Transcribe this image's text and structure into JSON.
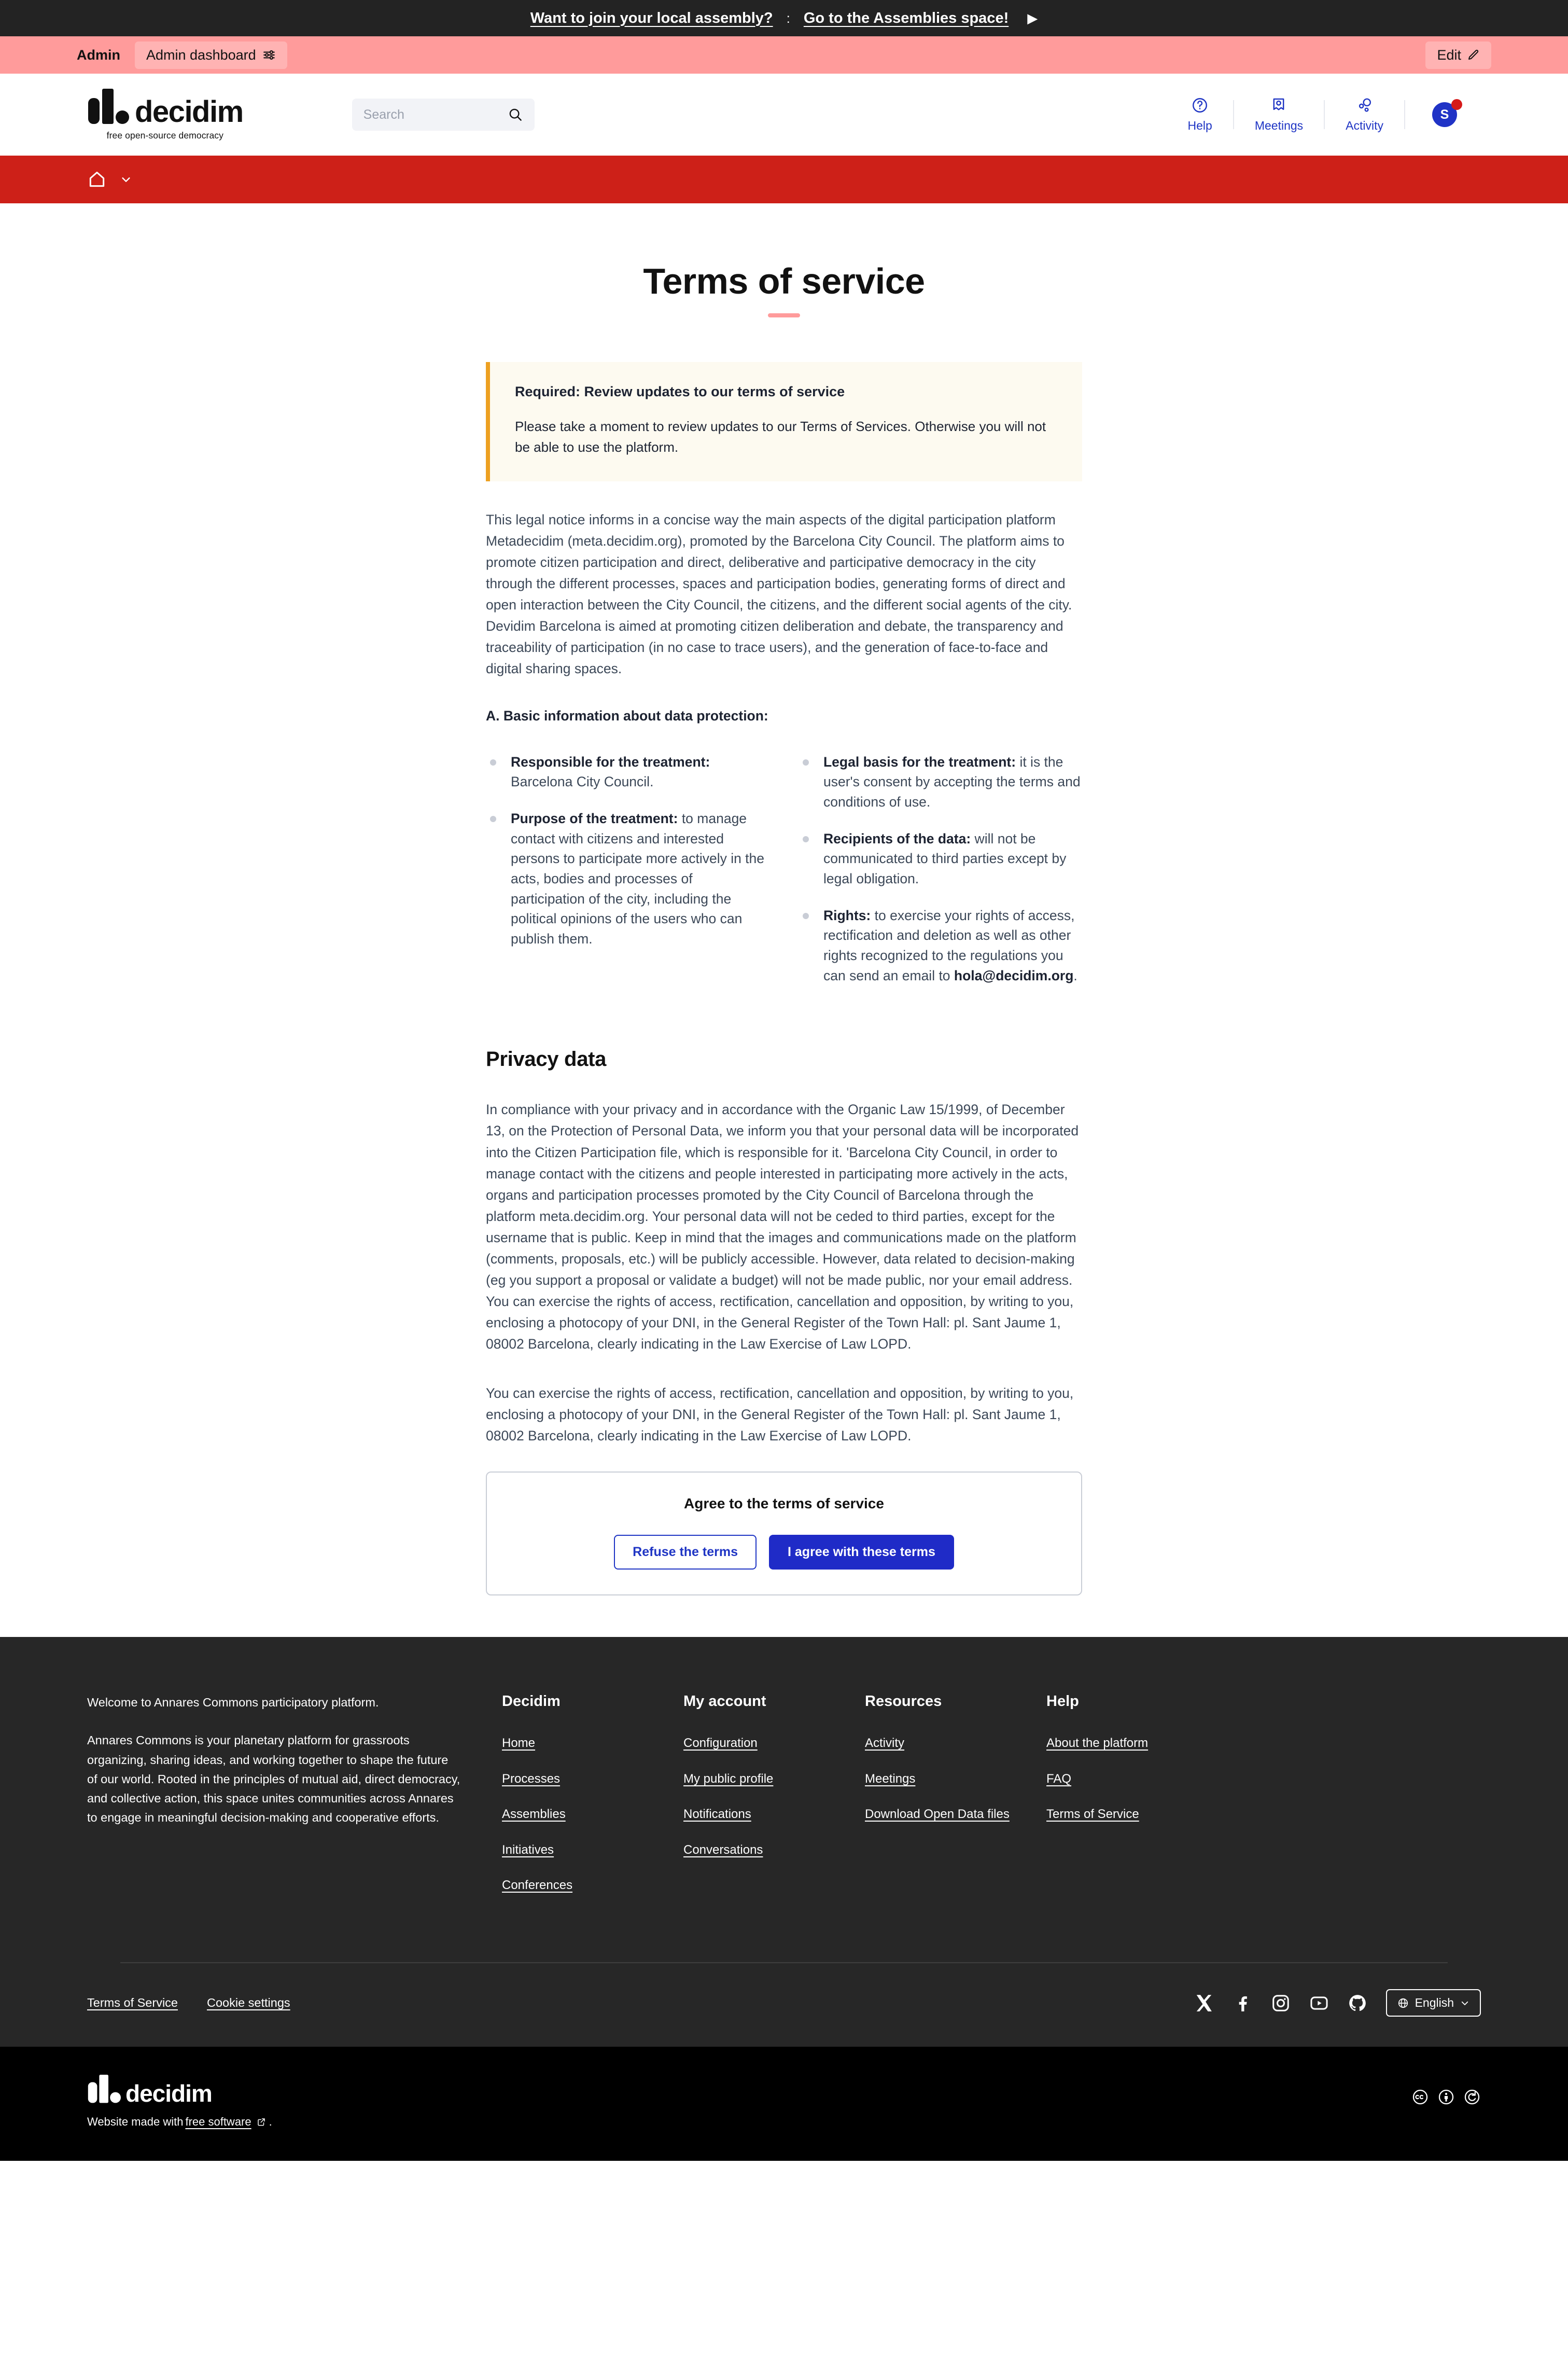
{
  "announcement": {
    "question": "Want to join your local assembly?",
    "separator": ":",
    "link": "Go to the Assemblies space!",
    "arrow": "▶"
  },
  "admin_bar": {
    "label": "Admin",
    "dashboard_button": "Admin dashboard",
    "edit_button": "Edit"
  },
  "header": {
    "logo_text": "decidim",
    "tagline": "free open-source democracy",
    "search_placeholder": "Search",
    "search_value": "",
    "actions": [
      {
        "label": "Help",
        "icon": "question-circle-icon"
      },
      {
        "label": "Meetings",
        "icon": "map-pin-icon"
      },
      {
        "label": "Activity",
        "icon": "activity-bubbles-icon"
      }
    ],
    "avatar_initial": "S",
    "avatar_has_notification": true
  },
  "navbar": {
    "home_icon": "home-icon",
    "chevron_icon": "chevron-down-icon"
  },
  "page": {
    "title": "Terms of service",
    "callout": {
      "title": "Required: Review updates to our terms of service",
      "body": "Please take a moment to review updates to our Terms of Services. Otherwise you will not be able to use the platform."
    },
    "intro_paragraph": "This legal notice informs in a concise way the main aspects of the digital participation platform Metadecidim (meta.decidim.org), promoted by the Barcelona City Council. The platform aims to promote citizen participation and direct, deliberative and participative democracy in the city through the different processes, spaces and participation bodies, generating forms of direct and open interaction between the City Council, the citizens, and the different social agents of the city. Devidim Barcelona is aimed at promoting citizen deliberation and debate, the transparency and traceability of participation (in no case to trace users), and the generation of face-to-face and digital sharing spaces.",
    "section_a_heading": "A. Basic information about data protection:",
    "bullets_left": [
      {
        "term": "Responsible for the treatment:",
        "text": " Barcelona City Council."
      },
      {
        "term": "Purpose of the treatment:",
        "text": " to manage contact with citizens and interested persons to participate more actively in the acts, bodies and processes of participation of the city, including the political opinions of the users who can publish them."
      }
    ],
    "bullets_right": [
      {
        "term": "Legal basis for the treatment:",
        "text": " it is the user's consent by accepting the terms and conditions of use."
      },
      {
        "term": "Recipients of the data:",
        "text": " will not be communicated to third parties except by legal obligation."
      },
      {
        "term": "Rights:",
        "text": " to exercise your rights of access, rectification and deletion as well as other rights recognized to the regulations you can send an email to ",
        "email": "hola@decidim.org",
        "suffix": "."
      }
    ],
    "privacy_heading": "Privacy data",
    "privacy_paragraph_1": "In compliance with your privacy and in accordance with the Organic Law 15/1999, of December 13, on the Protection of Personal Data, we inform you that your personal data will be incorporated into the Citizen Participation file, which is responsible for it. 'Barcelona City Council, in order to manage contact with the citizens and people interested in participating more actively in the acts, organs and participation processes promoted by the City Council of Barcelona through the platform meta.decidim.org. Your personal data will not be ceded to third parties, except for the username that is public. Keep in mind that the images and communications made on the platform (comments, proposals, etc.) will be publicly accessible. However, data related to decision-making (eg you support a proposal or validate a budget) will not be made public, nor your email address. You can exercise the rights of access, rectification, cancellation and opposition, by writing to you, enclosing a photocopy of your DNI, in the General Register of the Town Hall: pl. Sant Jaume 1, 08002 Barcelona, clearly indicating in the Law Exercise of Law LOPD.",
    "privacy_paragraph_2": "You can exercise the rights of access, rectification, cancellation and opposition, by writing to you, enclosing a photocopy of your DNI, in the General Register of the Town Hall: pl. Sant Jaume 1, 08002 Barcelona, clearly indicating in the Law Exercise of Law LOPD.",
    "agree_box": {
      "title": "Agree to the terms of service",
      "refuse_button": "Refuse the terms",
      "agree_button": "I agree with these terms"
    }
  },
  "footer": {
    "about_title": "Welcome to Annares Commons participatory platform.",
    "about_body": "Annares Commons is your planetary platform for grassroots organizing, sharing ideas, and working together to shape the future of our world. Rooted in the principles of mutual aid, direct democracy, and collective action, this space unites communities across Annares to engage in meaningful decision-making and cooperative efforts.",
    "columns": [
      {
        "heading": "Decidim",
        "links": [
          "Home",
          "Processes",
          "Assemblies",
          "Initiatives",
          "Conferences"
        ]
      },
      {
        "heading": "My account",
        "links": [
          "Configuration",
          "My public profile",
          "Notifications",
          "Conversations"
        ]
      },
      {
        "heading": "Resources",
        "links": [
          "Activity",
          "Meetings",
          "Download Open Data files"
        ]
      },
      {
        "heading": "Help",
        "links": [
          "About the platform",
          "FAQ",
          "Terms of Service"
        ]
      }
    ],
    "bottom_links": [
      "Terms of Service",
      "Cookie settings"
    ],
    "social": [
      {
        "name": "x-twitter-icon"
      },
      {
        "name": "facebook-icon"
      },
      {
        "name": "instagram-icon"
      },
      {
        "name": "youtube-icon"
      },
      {
        "name": "github-icon"
      }
    ],
    "language": "English",
    "brand_logo_text": "decidim",
    "made_with_prefix": "Website made with",
    "made_with_link": "free software",
    "made_with_suffix": ".",
    "license_icons": [
      "creative-commons-icon",
      "creative-commons-by-icon",
      "creative-commons-sa-icon"
    ]
  },
  "colors": {
    "announce_bg": "#232323",
    "admin_bg": "#ff9b9b",
    "nav_red": "#cd2018",
    "brand_blue": "#1f35c4",
    "callout_bg": "#fdfaf0",
    "callout_border": "#eda021",
    "accent_pink": "#ff9b9b",
    "footer_bg": "#272727"
  }
}
